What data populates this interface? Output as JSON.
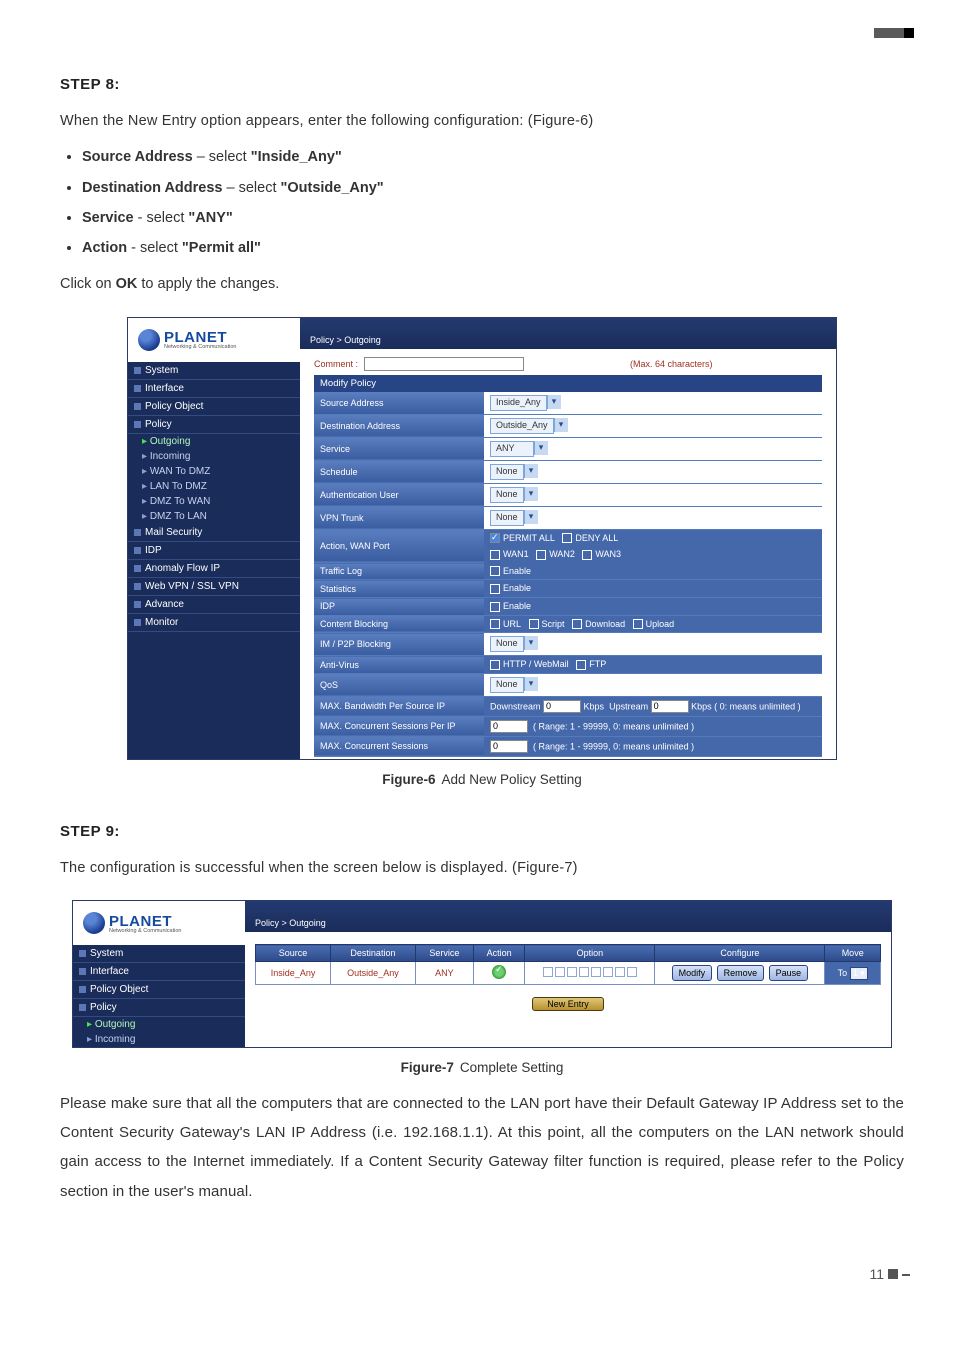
{
  "step8": {
    "title": "STEP 8:",
    "intro": "When the New Entry option appears, enter the following configuration: (Figure-6)",
    "bullets": [
      {
        "label": "Source Address",
        "middle": " – select ",
        "value": "\"Inside_Any\""
      },
      {
        "label": "Destination Address",
        "middle": " – select ",
        "value": "\"Outside_Any\""
      },
      {
        "label": "Service",
        "middle": " - select ",
        "value": "\"ANY\""
      },
      {
        "label": "Action",
        "middle": " - select ",
        "value": "\"Permit all\""
      }
    ],
    "closing_a": "Click on ",
    "closing_bold": "OK",
    "closing_b": " to apply the changes."
  },
  "fig6": {
    "crumb": "Policy > Outgoing",
    "logo": "PLANET",
    "logo_sub": "Networking & Communication",
    "sidebar_groups": [
      "System",
      "Interface",
      "Policy Object",
      "Policy"
    ],
    "sidebar_subs": [
      {
        "text": "Outgoing",
        "active": true
      },
      {
        "text": "Incoming"
      },
      {
        "text": "WAN To DMZ"
      },
      {
        "text": "LAN To DMZ"
      },
      {
        "text": "DMZ To WAN"
      },
      {
        "text": "DMZ To LAN"
      }
    ],
    "sidebar_tail": [
      "Mail Security",
      "IDP",
      "Anomaly Flow IP",
      "Web VPN / SSL VPN",
      "Advance",
      "Monitor"
    ],
    "comment_label": "Comment :",
    "comment_hint": "(Max. 64 characters)",
    "section_head": "Modify Policy",
    "rows": {
      "src": "Source Address",
      "src_v": "Inside_Any",
      "dst": "Destination Address",
      "dst_v": "Outside_Any",
      "svc": "Service",
      "svc_v": "ANY",
      "sch": "Schedule",
      "sch_v": "None",
      "auth": "Authentication User",
      "auth_v": "None",
      "vpn": "VPN Trunk",
      "vpn_v": "None",
      "action": "Action, WAN Port",
      "permit": "PERMIT ALL",
      "deny": "DENY ALL",
      "w1": "WAN1",
      "w2": "WAN2",
      "w3": "WAN3",
      "tlog": "Traffic Log",
      "tlog_v": "Enable",
      "stat": "Statistics",
      "stat_v": "Enable",
      "idp": "IDP",
      "idp_v": "Enable",
      "cb": "Content Blocking",
      "cb_url": "URL",
      "cb_scr": "Script",
      "cb_dl": "Download",
      "cb_up": "Upload",
      "p2p": "IM / P2P Blocking",
      "p2p_v": "None",
      "av": "Anti-Virus",
      "av_a": "HTTP / WebMail",
      "av_b": "FTP",
      "qos": "QoS",
      "qos_v": "None",
      "bw": "MAX. Bandwidth Per Source IP",
      "bw_dn": "Downstream",
      "bw_up": "Upstream",
      "bw_unit": "Kbps",
      "bw_note": "Kbps ( 0: means unlimited )",
      "mcspi": "MAX. Concurrent Sessions Per IP",
      "mcspi_hint": "( Range: 1 - 99999, 0: means unlimited )",
      "mcs": "MAX. Concurrent Sessions",
      "mcs_hint": "( Range: 1 - 99999, 0: means unlimited )",
      "zero": "0"
    },
    "caption_b": "Figure-6",
    "caption": "Add New Policy Setting"
  },
  "step9": {
    "title": "STEP 9:",
    "text": "The configuration is successful when the screen below is displayed. (Figure-7)"
  },
  "fig7": {
    "sidebar": [
      "System",
      "Interface",
      "Policy Object",
      "Policy"
    ],
    "sidebar_subs": [
      {
        "text": "Outgoing",
        "active": true
      },
      {
        "text": "Incoming"
      }
    ],
    "cols": [
      "Source",
      "Destination",
      "Service",
      "Action",
      "Option",
      "Configure",
      "Move"
    ],
    "row": {
      "src": "Inside_Any",
      "dst": "Outside_Any",
      "svc": "ANY",
      "btn_modify": "Modify",
      "btn_remove": "Remove",
      "btn_pause": "Pause",
      "move_to": "To",
      "move_v": "1"
    },
    "new_entry": "New Entry",
    "caption_b": "Figure-7",
    "caption": "Complete Setting"
  },
  "final": "Please make sure that all the computers that are connected to the LAN port have their Default Gateway IP Address set to the Content Security Gateway's LAN IP Address (i.e. 192.168.1.1). At this point, all the computers on the LAN network should gain access to the Internet immediately. If a Content Security Gateway filter function is required, please refer to the Policy section in the user's manual.",
  "page_no": "11"
}
